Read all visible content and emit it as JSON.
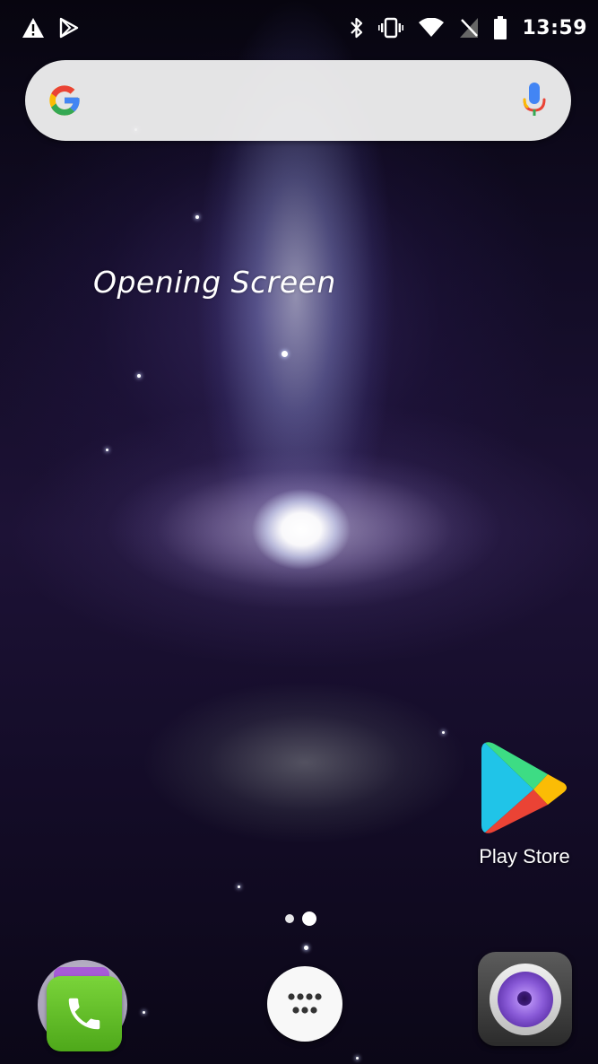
{
  "status_bar": {
    "time": "13:59",
    "left_icons": [
      "alert-triangle-icon",
      "play-protect-icon"
    ],
    "right_icons": [
      "bluetooth-icon",
      "vibrate-icon",
      "wifi-icon",
      "no-sim-icon",
      "battery-icon"
    ]
  },
  "search_bar": {
    "left_icon": "google-g-icon",
    "right_icon": "microphone-icon"
  },
  "wallpaper_text": "Opening Screen",
  "home_apps": [
    {
      "label": "Play Store",
      "icon": "play-store-icon"
    }
  ],
  "page_indicator": {
    "pages": 2,
    "current_page": 2
  },
  "dock": [
    {
      "icon": "phone-icon"
    },
    {
      "icon": "app-drawer-icon"
    },
    {
      "icon": "camera-icon"
    }
  ],
  "colors": {
    "google_blue": "#4285F4",
    "google_red": "#EA4335",
    "google_yellow": "#FBBC05",
    "google_green": "#34A853",
    "phone_green": "#5cb82a"
  }
}
